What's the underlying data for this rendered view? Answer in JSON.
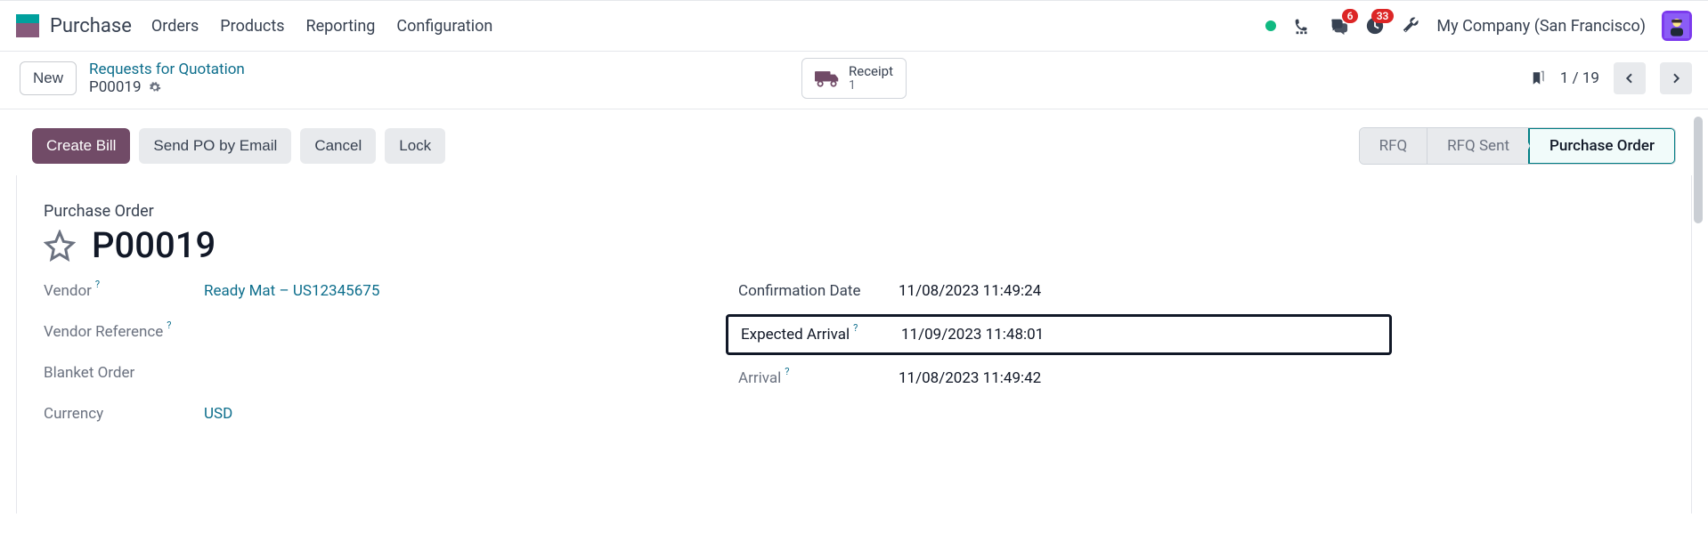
{
  "app": {
    "title": "Purchase",
    "nav": [
      "Orders",
      "Products",
      "Reporting",
      "Configuration"
    ],
    "badges": {
      "messages": "6",
      "activities": "33"
    },
    "company": "My Company (San Francisco)"
  },
  "subbar": {
    "new_label": "New",
    "breadcrumb_link": "Requests for Quotation",
    "breadcrumb_current": "P00019",
    "receipt_label": "Receipt",
    "receipt_count": "1",
    "pager": "1 / 19"
  },
  "actions": {
    "create_bill": "Create Bill",
    "send_po": "Send PO by Email",
    "cancel": "Cancel",
    "lock": "Lock"
  },
  "statusbar": {
    "rfq": "RFQ",
    "rfq_sent": "RFQ Sent",
    "po": "Purchase Order"
  },
  "record": {
    "type_label": "Purchase Order",
    "name": "P00019",
    "fields_left": {
      "vendor_label": "Vendor",
      "vendor_value": "Ready Mat – US12345675",
      "vendor_ref_label": "Vendor Reference",
      "blanket_label": "Blanket Order",
      "currency_label": "Currency",
      "currency_value": "USD"
    },
    "fields_right": {
      "confirm_label": "Confirmation Date",
      "confirm_value": "11/08/2023 11:49:24",
      "expected_label": "Expected Arrival",
      "expected_value": "11/09/2023 11:48:01",
      "arrival_label": "Arrival",
      "arrival_value": "11/08/2023 11:49:42"
    }
  }
}
